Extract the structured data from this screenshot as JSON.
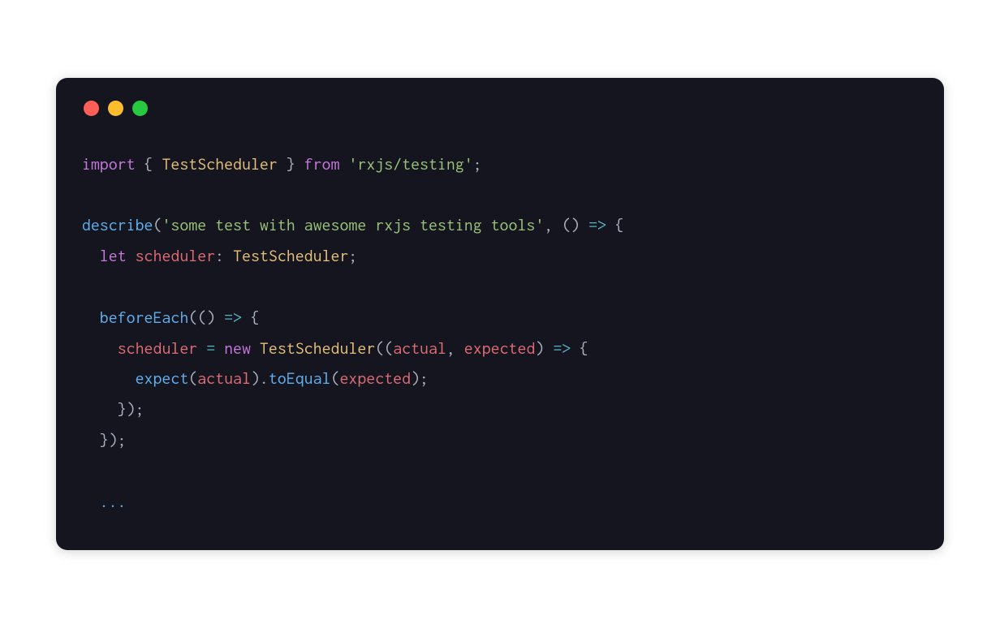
{
  "window": {
    "traffic_colors": {
      "red": "#ff5f56",
      "yellow": "#ffbd2e",
      "green": "#27c93f"
    },
    "background": "#15151f"
  },
  "code": {
    "l1": {
      "kw_import": "import",
      "brace_l": "{",
      "cls_testscheduler": "TestScheduler",
      "brace_r": "}",
      "kw_from": "from",
      "str_module": "'rxjs/testing'",
      "semi": ";"
    },
    "l3": {
      "fn_describe": "describe",
      "paren_l": "(",
      "str_desc": "'some test with awesome rxjs testing tools'",
      "comma": ",",
      "arrow_params": "()",
      "arrow": "=>",
      "brace_l": "{"
    },
    "l4": {
      "kw_let": "let",
      "var_scheduler": "scheduler",
      "colon": ":",
      "cls_type": "TestScheduler",
      "semi": ";"
    },
    "l6": {
      "fn_beforeeach": "beforeEach",
      "paren_l": "(",
      "arrow_params": "()",
      "arrow": "=>",
      "brace_l": "{"
    },
    "l7": {
      "var_scheduler": "scheduler",
      "eq": "=",
      "kw_new": "new",
      "cls_ctor": "TestScheduler",
      "paren_l": "(",
      "paren_inner_l": "(",
      "var_actual": "actual",
      "comma": ",",
      "var_expected": "expected",
      "paren_inner_r": ")",
      "arrow": "=>",
      "brace_l": "{"
    },
    "l8": {
      "fn_expect": "expect",
      "paren_l": "(",
      "var_actual": "actual",
      "paren_r": ")",
      "dot": ".",
      "fn_toequal": "toEqual",
      "paren_l2": "(",
      "var_expected": "expected",
      "paren_r2": ")",
      "semi": ";"
    },
    "l9": {
      "close": "});"
    },
    "l10": {
      "close": "});"
    },
    "l12": {
      "ellipsis": "..."
    }
  }
}
